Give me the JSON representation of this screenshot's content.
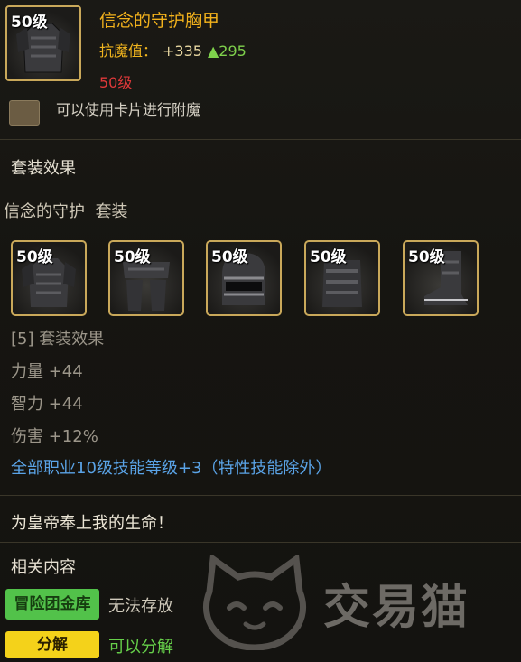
{
  "item": {
    "level_badge": "50级",
    "name": "信念的守护胸甲",
    "stat_label": "抗魔值：",
    "stat_value": "+335",
    "stat_increase": "▲295",
    "level_requirement": "50级",
    "card_note": "可以使用卡片进行附魔"
  },
  "set": {
    "section_title": "套装效果",
    "set_name": "信念的守护",
    "set_suffix": "套装",
    "pieces": [
      {
        "level_badge": "50级",
        "icon": "chest-armor-icon"
      },
      {
        "level_badge": "50级",
        "icon": "leg-armor-icon"
      },
      {
        "level_badge": "50级",
        "icon": "helmet-icon"
      },
      {
        "level_badge": "50级",
        "icon": "belt-armor-icon"
      },
      {
        "level_badge": "50级",
        "icon": "boots-icon"
      }
    ],
    "effect_header": "[5] 套装效果",
    "effects": [
      "力量 +44",
      "智力 +44",
      "伤害 +12%"
    ],
    "skill_bonus": "全部职业10级技能等级+3（特性技能除外）"
  },
  "flavor_text": "为皇帝奉上我的生命！",
  "related": {
    "title": "相关内容",
    "storage_button": "冒险团金库",
    "storage_status": "无法存放",
    "decompose_button": "分解",
    "decompose_status": "可以分解"
  },
  "watermark": {
    "text": "交易猫",
    "icon": "cat-logo-icon"
  },
  "colors": {
    "title": "#f3b21c",
    "stat_up": "#7fd14c",
    "level_req": "#e0393a",
    "frame_gold": "#c9a85a",
    "skill_blue": "#5aa3e6",
    "button_green": "#52c24a",
    "button_yellow": "#f4d21a"
  }
}
